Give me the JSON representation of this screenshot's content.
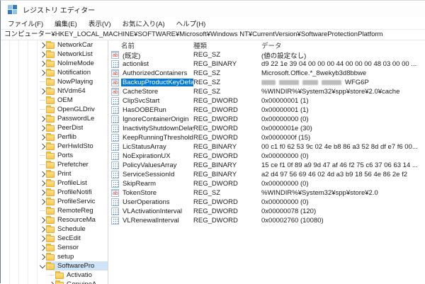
{
  "window": {
    "title": "レジストリ エディター"
  },
  "menu_bar": {
    "items": [
      "ファイル(F)",
      "編集(E)",
      "表示(V)",
      "お気に入り(A)",
      "ヘルプ(H)"
    ]
  },
  "address_bar": {
    "value": "コンピューター¥HKEY_LOCAL_MACHINE¥SOFTWARE¥Microsoft¥Windows NT¥CurrentVersion¥SoftwareProtectionPlatform"
  },
  "tree": {
    "items": [
      {
        "label": "NetworkCar",
        "state": "collapsed",
        "level": 0,
        "selected": false
      },
      {
        "label": "NetworkList",
        "state": "collapsed",
        "level": 0,
        "selected": false
      },
      {
        "label": "NoImeMode",
        "state": "collapsed",
        "level": 0,
        "selected": false
      },
      {
        "label": "Notification",
        "state": "collapsed",
        "level": 0,
        "selected": false
      },
      {
        "label": "NowPlaying",
        "state": "leaf",
        "level": 0,
        "selected": false
      },
      {
        "label": "NtVdm64",
        "state": "collapsed",
        "level": 0,
        "selected": false
      },
      {
        "label": "OEM",
        "state": "leaf",
        "level": 0,
        "selected": false
      },
      {
        "label": "OpenGLDriv",
        "state": "leaf",
        "level": 0,
        "selected": false
      },
      {
        "label": "PasswordLe",
        "state": "collapsed",
        "level": 0,
        "selected": false
      },
      {
        "label": "PeerDist",
        "state": "collapsed",
        "level": 0,
        "selected": false
      },
      {
        "label": "Perflib",
        "state": "collapsed",
        "level": 0,
        "selected": false
      },
      {
        "label": "PerHwIdSto",
        "state": "collapsed",
        "level": 0,
        "selected": false
      },
      {
        "label": "Ports",
        "state": "leaf",
        "level": 0,
        "selected": false
      },
      {
        "label": "Prefetcher",
        "state": "leaf",
        "level": 0,
        "selected": false
      },
      {
        "label": "Print",
        "state": "collapsed",
        "level": 0,
        "selected": false
      },
      {
        "label": "ProfileList",
        "state": "collapsed",
        "level": 0,
        "selected": false
      },
      {
        "label": "ProfileNotifi",
        "state": "collapsed",
        "level": 0,
        "selected": false
      },
      {
        "label": "ProfileServic",
        "state": "collapsed",
        "level": 0,
        "selected": false
      },
      {
        "label": "RemoteReg",
        "state": "leaf",
        "level": 0,
        "selected": false
      },
      {
        "label": "ResourceMa",
        "state": "collapsed",
        "level": 0,
        "selected": false
      },
      {
        "label": "Schedule",
        "state": "collapsed",
        "level": 0,
        "selected": false
      },
      {
        "label": "SecEdit",
        "state": "collapsed",
        "level": 0,
        "selected": false
      },
      {
        "label": "Sensor",
        "state": "collapsed",
        "level": 0,
        "selected": false
      },
      {
        "label": "setup",
        "state": "collapsed",
        "level": 0,
        "selected": false
      },
      {
        "label": "SoftwarePro",
        "state": "expanded",
        "level": 0,
        "selected": true
      },
      {
        "label": "Activatio",
        "state": "leaf",
        "level": 1,
        "selected": false
      },
      {
        "label": "GenuineA",
        "state": "collapsed",
        "level": 1,
        "selected": false
      }
    ]
  },
  "list": {
    "columns": [
      "名前",
      "種類",
      "データ"
    ],
    "rows": [
      {
        "name": "(既定)",
        "type": "REG_SZ",
        "data": "(値の設定なし)",
        "icon": "string",
        "selected": false,
        "redacted": false
      },
      {
        "name": "actionlist",
        "type": "REG_BINARY",
        "data": "d9 22 1e 39 04 00 00 00 44 00 00 00 48 03 00 00 ...",
        "icon": "binary",
        "selected": false,
        "redacted": false
      },
      {
        "name": "AuthorizedContainers",
        "type": "REG_SZ",
        "data": "Microsoft.Office.*_8wekyb3d8bbwe",
        "icon": "string",
        "selected": false,
        "redacted": false
      },
      {
        "name": "BackupProductKeyDefault",
        "type": "REG_SZ",
        "data": "WFG6P",
        "icon": "string",
        "selected": true,
        "redacted": true
      },
      {
        "name": "CacheStore",
        "type": "REG_SZ",
        "data": "%WINDIR%¥System32¥spp¥store¥2.0¥cache",
        "icon": "string",
        "selected": false,
        "redacted": false
      },
      {
        "name": "ClipSvcStart",
        "type": "REG_DWORD",
        "data": "0x00000001 (1)",
        "icon": "binary",
        "selected": false,
        "redacted": false
      },
      {
        "name": "HasOOBERun",
        "type": "REG_DWORD",
        "data": "0x00000001 (1)",
        "icon": "binary",
        "selected": false,
        "redacted": false
      },
      {
        "name": "IgnoreContainerOrigin",
        "type": "REG_DWORD",
        "data": "0x00000000 (0)",
        "icon": "binary",
        "selected": false,
        "redacted": false
      },
      {
        "name": "InactivityShutdownDelay",
        "type": "REG_DWORD",
        "data": "0x0000001e (30)",
        "icon": "binary",
        "selected": false,
        "redacted": false
      },
      {
        "name": "KeepRunningThresholdMins",
        "type": "REG_DWORD",
        "data": "0x0000000f (15)",
        "icon": "binary",
        "selected": false,
        "redacted": false
      },
      {
        "name": "LicStatusArray",
        "type": "REG_BINARY",
        "data": "00 c1 f0 62 53 9c 02 4e b8 86 a3 52 8d df e7 f6 00...",
        "icon": "binary",
        "selected": false,
        "redacted": false
      },
      {
        "name": "NoExpirationUX",
        "type": "REG_DWORD",
        "data": "0x00000000 (0)",
        "icon": "binary",
        "selected": false,
        "redacted": false
      },
      {
        "name": "PolicyValuesArray",
        "type": "REG_BINARY",
        "data": "15 ce f1 0f 89 a9 9d 47 af 46 f2 75 c6 37 06 63 14 ...",
        "icon": "binary",
        "selected": false,
        "redacted": false
      },
      {
        "name": "ServiceSessionId",
        "type": "REG_BINARY",
        "data": "a2 d4 97 56 69 46 02 4d a3 b9 18 56 4e 86 2e f2",
        "icon": "binary",
        "selected": false,
        "redacted": false
      },
      {
        "name": "SkipRearm",
        "type": "REG_DWORD",
        "data": "0x00000000 (0)",
        "icon": "binary",
        "selected": false,
        "redacted": false
      },
      {
        "name": "TokenStore",
        "type": "REG_SZ",
        "data": "%WINDIR%¥System32¥spp¥store¥2.0",
        "icon": "string",
        "selected": false,
        "redacted": false
      },
      {
        "name": "UserOperations",
        "type": "REG_DWORD",
        "data": "0x00000000 (0)",
        "icon": "binary",
        "selected": false,
        "redacted": false
      },
      {
        "name": "VLActivationInterval",
        "type": "REG_DWORD",
        "data": "0x00000078 (120)",
        "icon": "binary",
        "selected": false,
        "redacted": false
      },
      {
        "name": "VLRenewalInterval",
        "type": "REG_DWORD",
        "data": "0x00002760 (10080)",
        "icon": "binary",
        "selected": false,
        "redacted": false
      }
    ]
  },
  "colors": {
    "selection_active": "#0078d7",
    "selection_inactive": "#cfe5f7",
    "folder": "#f9c74b",
    "reg_sz_icon_text": "#c93a2e",
    "binary_icon_dot": "#3c76c2"
  }
}
